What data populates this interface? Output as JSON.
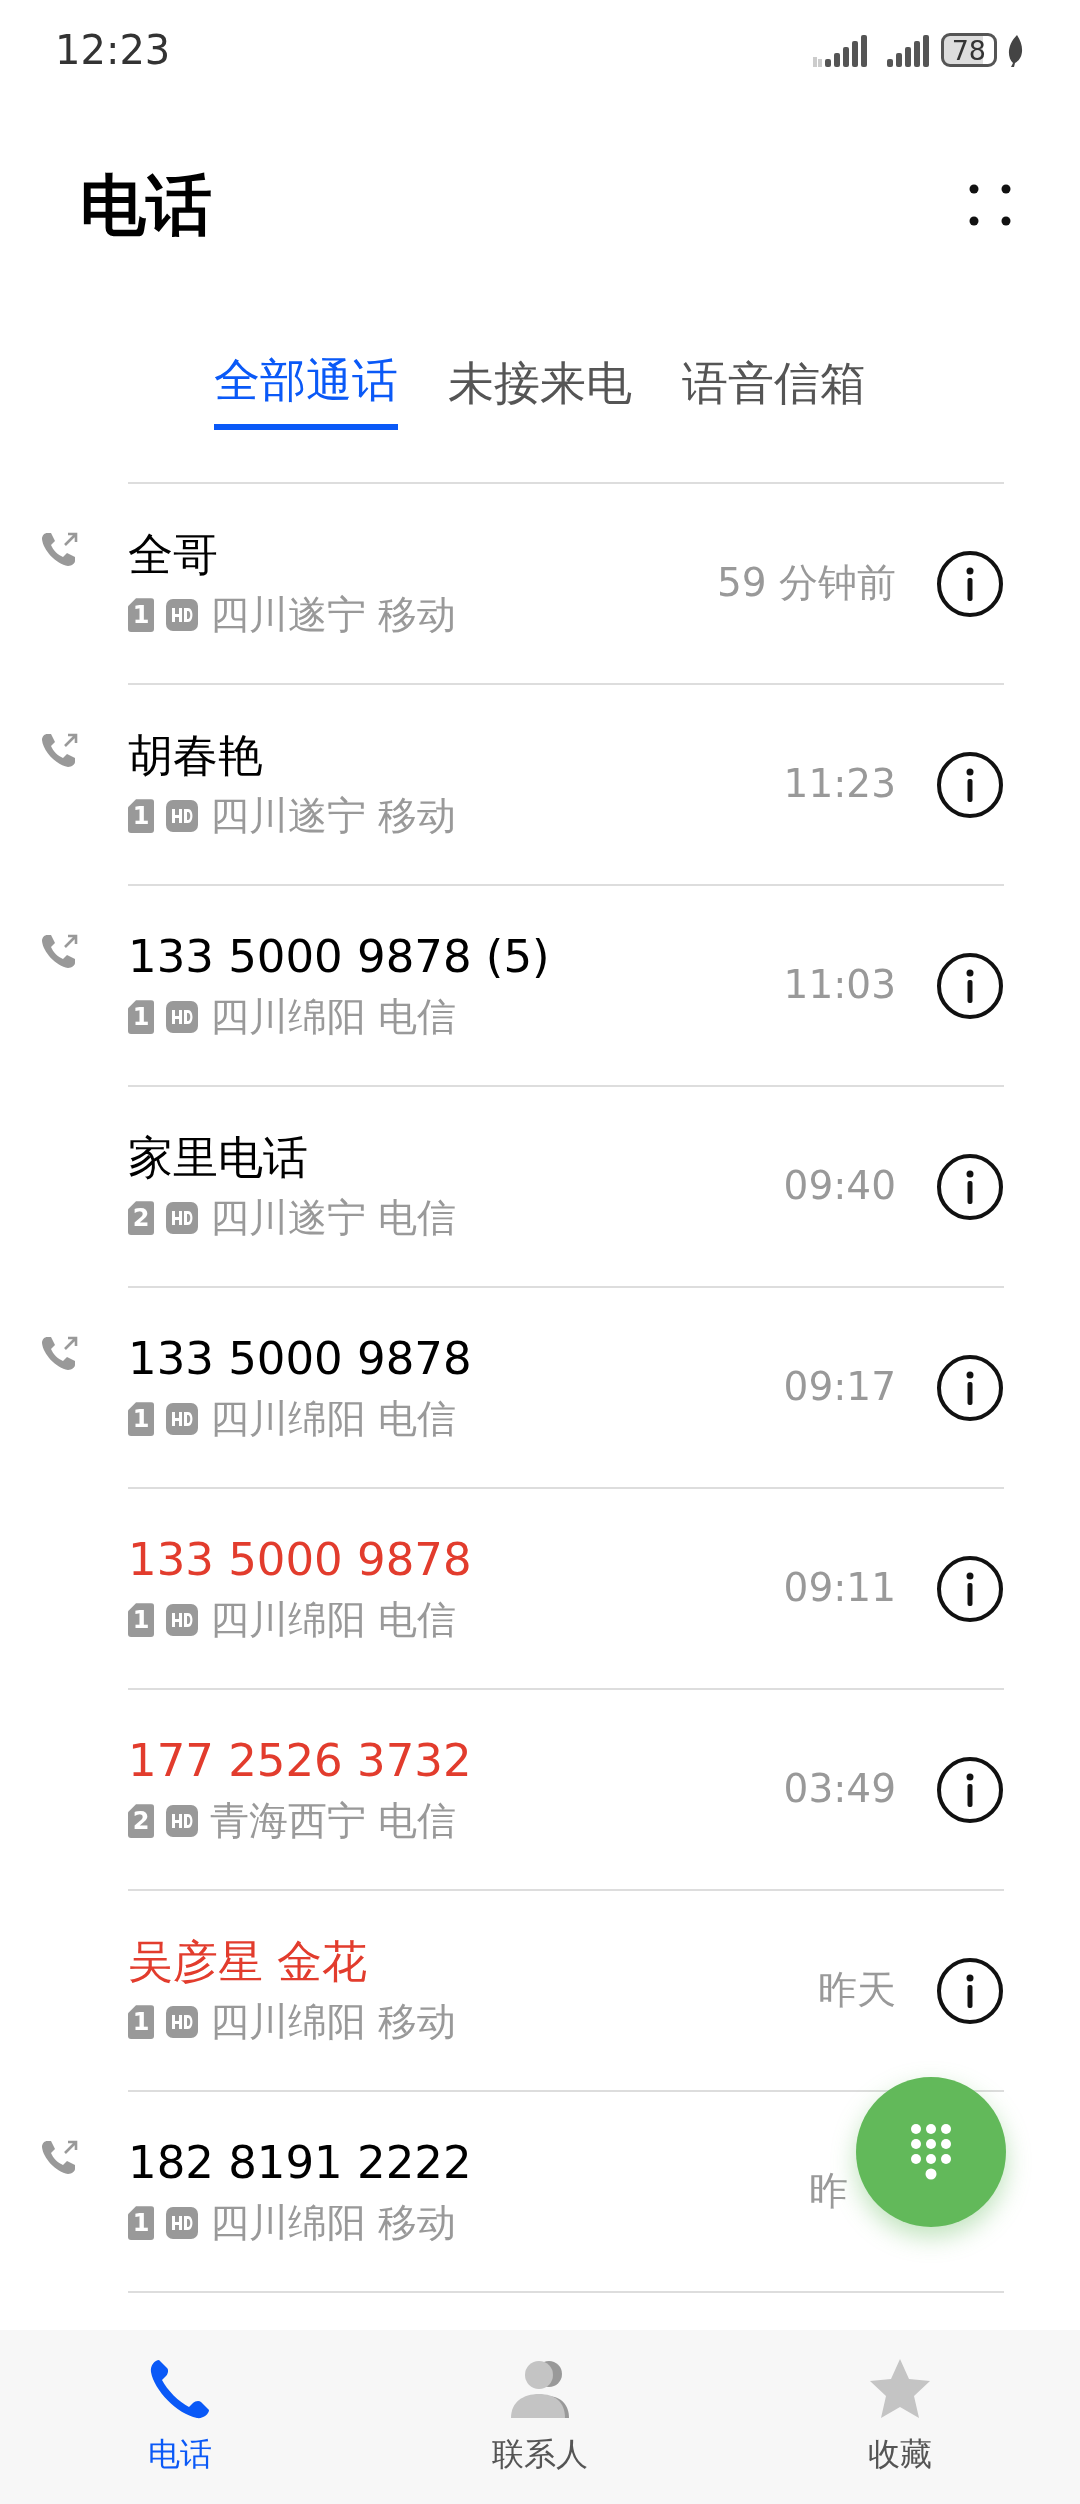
{
  "status_bar": {
    "time": "12:23",
    "battery": "78"
  },
  "header": {
    "title": "电话"
  },
  "tabs": [
    {
      "label": "全部通话",
      "selected": true
    },
    {
      "label": "未接来电",
      "selected": false
    },
    {
      "label": "语音信箱",
      "selected": false
    }
  ],
  "calls": [
    {
      "name": "全哥",
      "missed": false,
      "outgoing": true,
      "sim": "1",
      "location": "四川遂宁 移动",
      "time": "59 分钟前",
      "info": true
    },
    {
      "name": "胡春艳",
      "missed": false,
      "outgoing": true,
      "sim": "1",
      "location": "四川遂宁 移动",
      "time": "11:23",
      "info": true
    },
    {
      "name": "133 5000 9878 (5)",
      "missed": false,
      "outgoing": true,
      "sim": "1",
      "location": "四川绵阳 电信",
      "time": "11:03",
      "info": true
    },
    {
      "name": "家里电话",
      "missed": false,
      "outgoing": false,
      "sim": "2",
      "location": "四川遂宁 电信",
      "time": "09:40",
      "info": true
    },
    {
      "name": "133 5000 9878",
      "missed": false,
      "outgoing": true,
      "sim": "1",
      "location": "四川绵阳 电信",
      "time": "09:17",
      "info": true
    },
    {
      "name": "133 5000 9878",
      "missed": true,
      "outgoing": false,
      "sim": "1",
      "location": "四川绵阳 电信",
      "time": "09:11",
      "info": true
    },
    {
      "name": "177 2526 3732",
      "missed": true,
      "outgoing": false,
      "sim": "2",
      "location": "青海西宁 电信",
      "time": "03:49",
      "info": true
    },
    {
      "name": "吴彦星 金花",
      "missed": true,
      "outgoing": false,
      "sim": "1",
      "location": "四川绵阳 移动",
      "time": "昨天",
      "info": true
    },
    {
      "name": "182 8191 2222",
      "missed": false,
      "outgoing": true,
      "sim": "1",
      "location": "四川绵阳 移动",
      "time": "昨",
      "info": false
    }
  ],
  "bottom_nav": [
    {
      "label": "电话",
      "kind": "phone",
      "selected": true
    },
    {
      "label": "联系人",
      "kind": "contacts",
      "selected": false
    },
    {
      "label": "收藏",
      "kind": "favorites",
      "selected": false
    }
  ]
}
